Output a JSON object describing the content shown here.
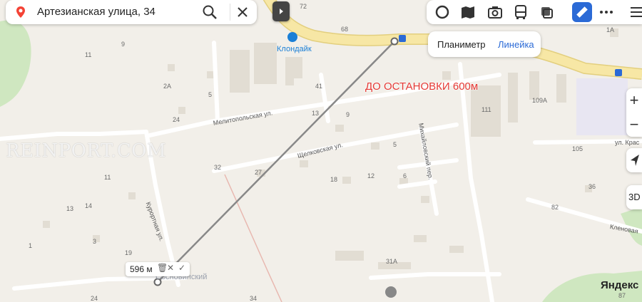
{
  "search": {
    "query": "Артезианская улица, 34"
  },
  "ruler": {
    "planimeter": "Планиметр",
    "ruler": "Линейка",
    "distance": "596 м"
  },
  "map": {
    "annotation": "ДО ОСТАНОВКИ 600м",
    "poi": "Клондайк",
    "place": "Сосновинский",
    "watermark": "REINPORT.COM",
    "logo": "Яндекс",
    "streets": {
      "melitopolskaya": "Мелитопольская ул.",
      "shchelkovskaya": "Щелковская ул.",
      "mikhailovsky": "Михайловский пер.",
      "kurortnaya": "Курортная ул.",
      "krasnaya": "ул. Крас",
      "klenovaya": "Кленовая"
    },
    "houses": {
      "h72": "72",
      "h68": "68",
      "h9a": "9",
      "h11a": "11",
      "h2a": "2А",
      "h5": "5",
      "h41": "41",
      "h13": "13",
      "h9b": "9",
      "h24": "24",
      "h111": "111",
      "h109a": "109А",
      "h1a": "1А",
      "h105": "105",
      "h5b": "5",
      "h27": "27",
      "h32": "32",
      "h18": "18",
      "h12": "12",
      "h6": "6",
      "h11b": "11",
      "h13b": "13",
      "h14": "14",
      "h3": "3",
      "h1": "1",
      "h19": "19",
      "h36": "36",
      "h82": "82",
      "h31a": "31А",
      "h24b": "24",
      "h34": "34",
      "h87": "87"
    }
  },
  "controls": {
    "plus": "+",
    "minus": "−",
    "view3d": "3D"
  },
  "colors": {
    "road_main": "#f7e7a5",
    "road": "#ffffff",
    "forest": "#cfe7c0",
    "building": "#e2ddd3",
    "accent": "#2b6ad6",
    "annotation": "#e53935",
    "pin": "#f44336"
  }
}
